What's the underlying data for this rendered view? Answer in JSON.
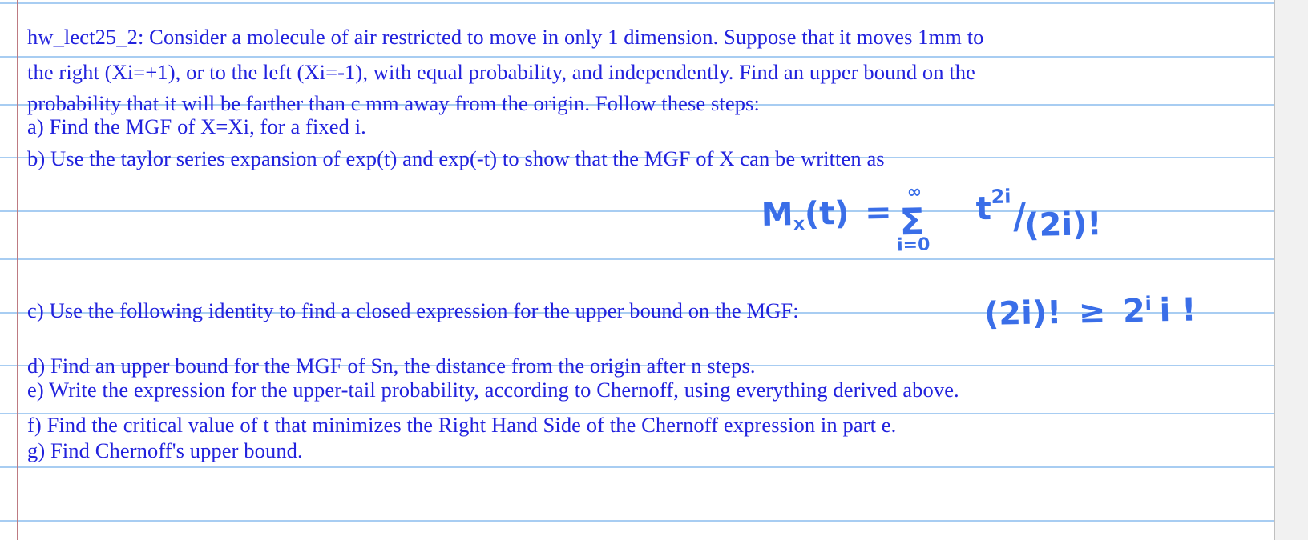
{
  "page": {
    "background_color": "#ffffff",
    "gutter_color": "#f1f1f1",
    "rule_color": "#a8cdf2",
    "margin_rule_color": "#bd7b82",
    "text_color": "#2222dd",
    "ink_color": "#3a6ee8"
  },
  "note": {
    "title_prefix": "hw_lect25_2:",
    "lines": [
      {
        "id": "line-1",
        "text": "hw_lect25_2: Consider a molecule of air restricted to move in only 1 dimension. Suppose that it moves 1mm to"
      },
      {
        "id": "line-2",
        "text": "the right (Xi=+1), or to the left (Xi=-1), with equal probability, and independently. Find an upper bound on the"
      },
      {
        "id": "line-3",
        "text": "probability that it will be farther than c mm away from the origin. Follow these steps:"
      },
      {
        "id": "line-4",
        "text": "a) Find the MGF of X=Xi, for a fixed i."
      },
      {
        "id": "line-5",
        "text": "b) Use the taylor series expansion of exp(t) and exp(-t) to show that the MGF of X can be written as"
      },
      {
        "id": "line-6",
        "text": "c) Use the following identity to find a closed expression for the upper bound on the MGF:"
      },
      {
        "id": "line-7",
        "text": "d) Find an upper bound for the MGF of Sn, the distance from the origin after n steps."
      },
      {
        "id": "line-8",
        "text": "e) Write the expression for the upper-tail probability, according to Chernoff, using everything derived above."
      },
      {
        "id": "line-9",
        "text": "f) Find the critical value of t that minimizes the Right Hand Side of the Chernoff expression in part e."
      },
      {
        "id": "line-10",
        "text": "g) Find Chernoff's upper bound."
      }
    ]
  },
  "handwriting": {
    "formula_mgf": {
      "lhs": "M",
      "lhs_sub": "x",
      "lhs_arg": "(t)",
      "equals": "=",
      "sum_upper": "∞",
      "sum_symbol": "Σ",
      "sum_lower": "i=0",
      "numerator": "t",
      "numerator_exponent": "2i",
      "slash": "/",
      "denominator": "(2i)!",
      "plain": "M_x(t) = Σ (i=0 to ∞) t^(2i) / (2i)!"
    },
    "formula_identity": {
      "left": "(2i)!",
      "relation": "≥",
      "right_base": "2",
      "right_exponent": "i",
      "right_tail": "i !",
      "plain": "(2i)! ≥ 2^i i!"
    }
  }
}
